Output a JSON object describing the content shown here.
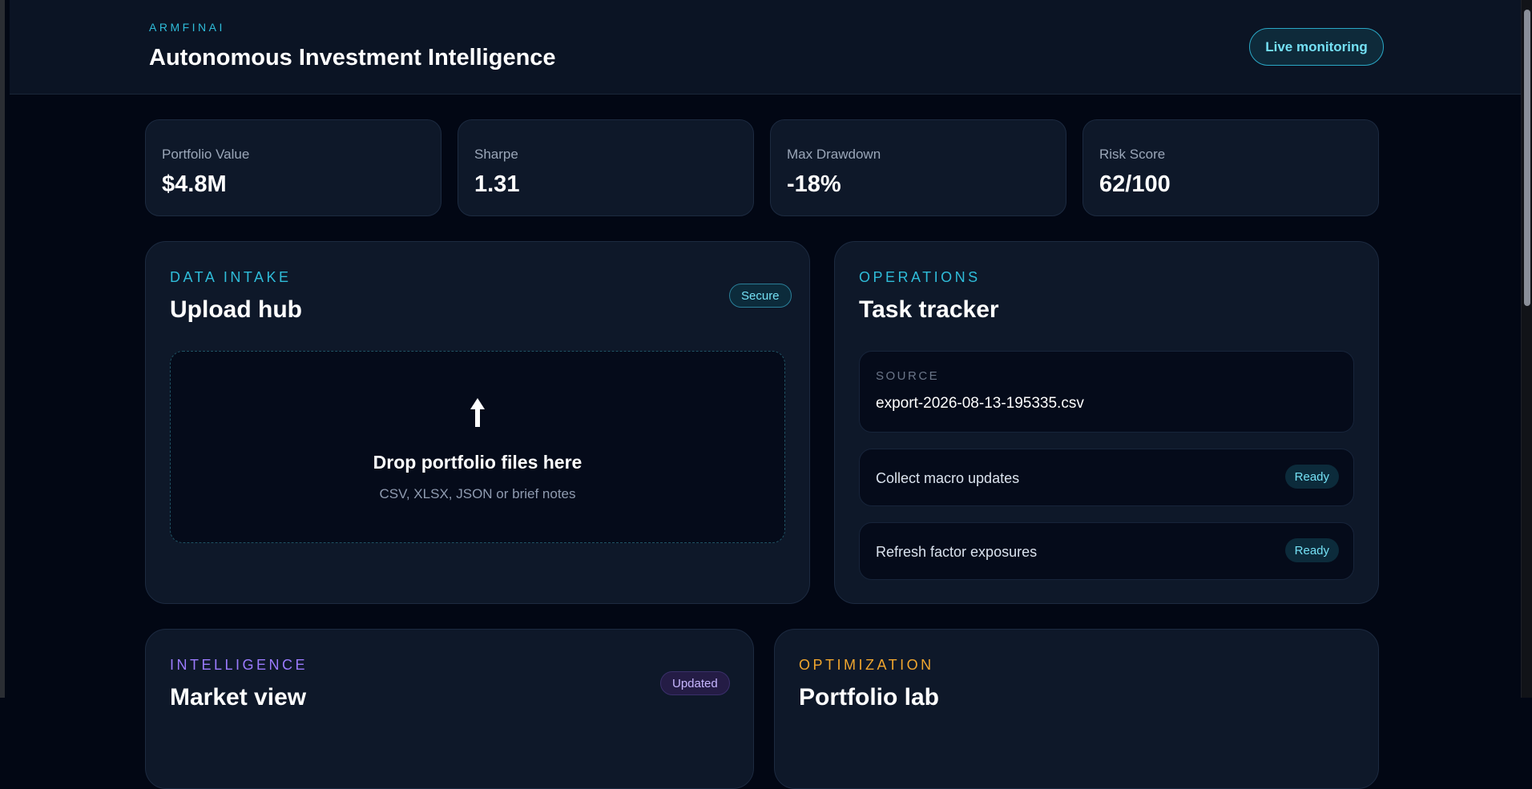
{
  "header": {
    "brand": "ARMFINAI",
    "title": "Autonomous Investment Intelligence",
    "live_label": "Live monitoring"
  },
  "stats": [
    {
      "label": "Portfolio Value",
      "value": "$4.8M"
    },
    {
      "label": "Sharpe",
      "value": "1.31"
    },
    {
      "label": "Max Drawdown",
      "value": "-18%"
    },
    {
      "label": "Risk Score",
      "value": "62/100"
    }
  ],
  "upload": {
    "eyebrow": "DATA INTAKE",
    "title": "Upload hub",
    "badge": "Secure",
    "drop_title": "Drop portfolio files here",
    "drop_sub": "CSV, XLSX, JSON or brief notes",
    "icon": "upload-arrow-icon"
  },
  "tasks": {
    "eyebrow": "OPERATIONS",
    "title": "Task tracker",
    "source_label": "SOURCE",
    "source_value": "export-2026-08-13-195335.csv",
    "items": [
      {
        "label": "Collect macro updates",
        "status": "Ready"
      },
      {
        "label": "Refresh factor exposures",
        "status": "Ready"
      }
    ]
  },
  "intelligence": {
    "eyebrow": "INTELLIGENCE",
    "title": "Market view",
    "badge": "Updated"
  },
  "optimization": {
    "eyebrow": "OPTIMIZATION",
    "title": "Portfolio lab"
  },
  "colors": {
    "accent_cyan": "#2fbcd9",
    "accent_purple": "#9b7bff",
    "accent_amber": "#f0a62e",
    "background": "#020714",
    "card": "#0e1829"
  }
}
